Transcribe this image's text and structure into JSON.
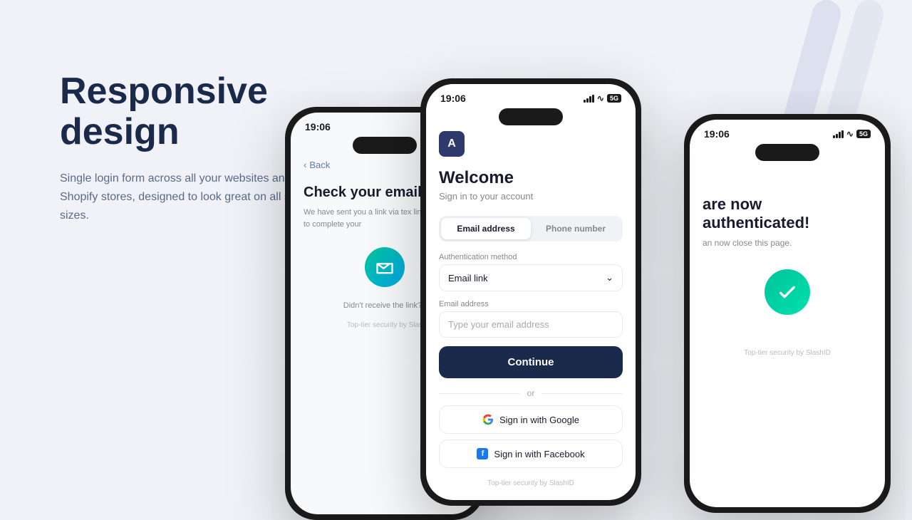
{
  "page": {
    "background": "#f0f2f7"
  },
  "left": {
    "heading_line1": "Responsive",
    "heading_line2": "design",
    "subtext": "Single login form across all your websites and Shopify stores, designed to look great on all screen sizes."
  },
  "phone_left": {
    "time": "19:06",
    "back_label": "Back",
    "title": "Check your email",
    "subtitle": "We have sent you a link via tex link provided to complete your",
    "resend_text": "Didn't receive the link? I",
    "security_footer": "Top-tier security by Slas"
  },
  "phone_center": {
    "time": "19:06",
    "app_letter": "A",
    "welcome_title": "Welcome",
    "welcome_sub": "Sign in to your account",
    "tab_email": "Email address",
    "tab_phone": "Phone number",
    "auth_label": "Authentication method",
    "auth_value": "Email link",
    "email_label": "Email address",
    "email_placeholder": "Type your email address",
    "continue_label": "Continue",
    "or_text": "or",
    "google_label": "Sign in with Google",
    "facebook_label": "Sign in with Facebook",
    "security_footer": "Top-tier security by SlashID"
  },
  "phone_right": {
    "time": "19:06",
    "auth_title": "are now authenticated!",
    "auth_sub": "an now close this page.",
    "security_footer": "Top-tier security by SlashID"
  }
}
